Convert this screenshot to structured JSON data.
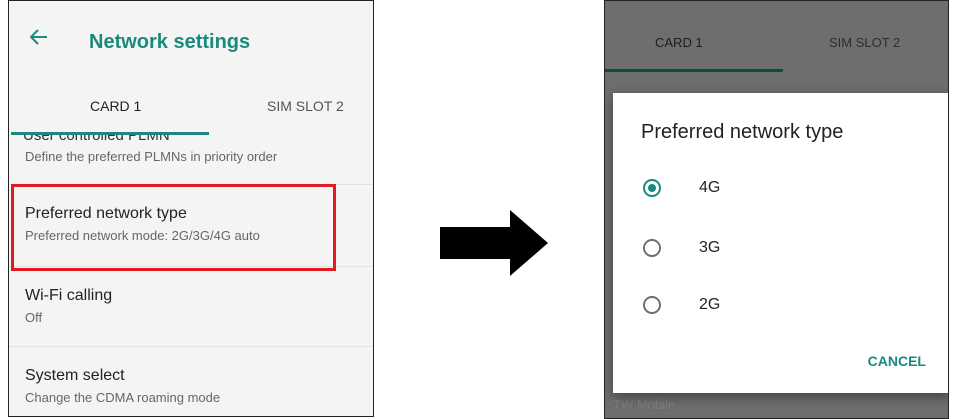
{
  "left": {
    "title": "Network settings",
    "tabs": [
      "CARD 1",
      "SIM SLOT 2"
    ],
    "partial_item_title": "User controlled PLMN",
    "partial_item_sub": "Define the preferred PLMNs in priority order",
    "items": [
      {
        "title": "Preferred network type",
        "subtitle": "Preferred network mode: 2G/3G/4G auto"
      },
      {
        "title": "Wi-Fi calling",
        "subtitle": "Off"
      },
      {
        "title": "System select",
        "subtitle": "Change the CDMA roaming mode"
      }
    ],
    "colors": {
      "accent": "#1a8a7e",
      "highlight": "#e01b22"
    }
  },
  "arrow_icon": "right-arrow-icon",
  "right": {
    "tabs": [
      "CARD 1",
      "SIM SLOT 2"
    ],
    "dialog": {
      "title": "Preferred network type",
      "options": [
        {
          "label": "4G",
          "selected": true
        },
        {
          "label": "3G",
          "selected": false
        },
        {
          "label": "2G",
          "selected": false
        }
      ],
      "cancel": "CANCEL"
    },
    "behind_text": "TW Mobile"
  }
}
